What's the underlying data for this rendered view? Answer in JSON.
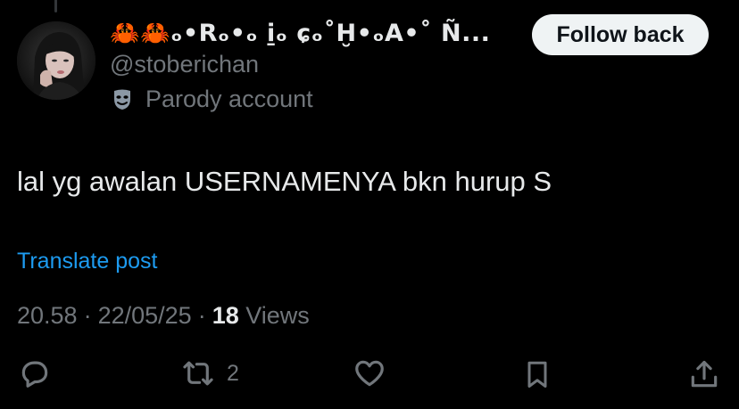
{
  "author": {
    "display_name_crabs": "🦀🦀",
    "display_name": "ₒ•Rₒ•ₒ i̱ₒ ɕₒ˚Ḫ•ₒA•˚ Ñ...",
    "handle": "@stoberichan",
    "label": "Parody account",
    "label_icon": "mask-icon",
    "avatar_icon": "avatar-photo"
  },
  "follow_button": {
    "label": "Follow back"
  },
  "post": {
    "text": "lal yg awalan USERNAMENYA bkn hurup S",
    "translate_label": "Translate post"
  },
  "meta": {
    "time": "20.58",
    "separator": "·",
    "date": "22/05/25",
    "views_count": "18",
    "views_label": "Views"
  },
  "actions": {
    "reply": {
      "icon": "reply-icon"
    },
    "repost": {
      "icon": "repost-icon",
      "count": "2"
    },
    "like": {
      "icon": "heart-icon"
    },
    "bookmark": {
      "icon": "bookmark-icon"
    },
    "share": {
      "icon": "share-icon"
    }
  },
  "colors": {
    "background": "#000000",
    "text_primary": "#e7e9ea",
    "text_secondary": "#71767b",
    "link": "#1d9bf0",
    "button_bg": "#eff3f4"
  }
}
